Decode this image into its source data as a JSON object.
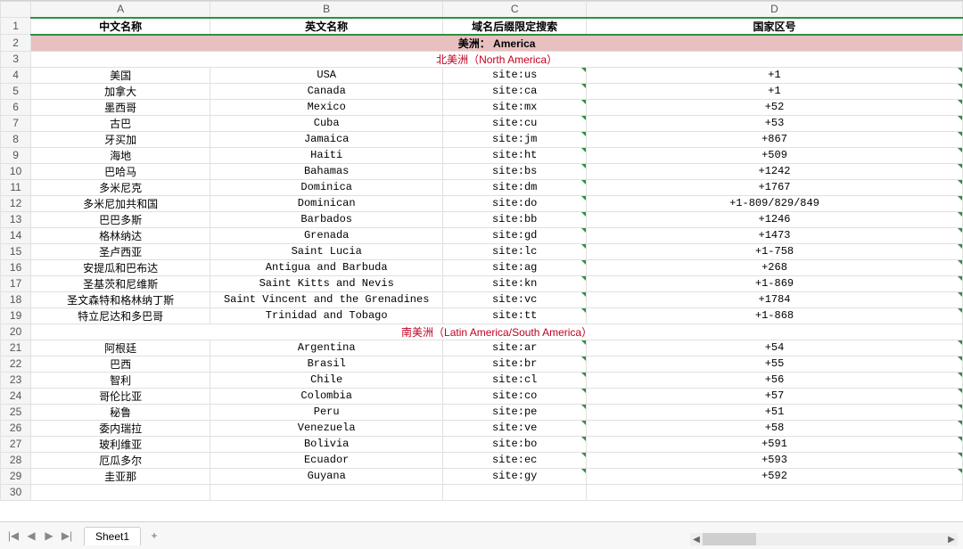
{
  "columns": [
    "A",
    "B",
    "C",
    "D"
  ],
  "headers": {
    "cn_name": "中文名称",
    "en_name": "英文名称",
    "site_search": "域名后缀限定搜索",
    "dial_code": "国家区号"
  },
  "band": {
    "label": "美洲： America"
  },
  "region_na": "北美洲（North America）",
  "region_sa": "南美洲（Latin America/South America）",
  "rows_na": [
    {
      "cn": "美国",
      "en": "USA",
      "site": "site:us",
      "code": "+1"
    },
    {
      "cn": "加拿大",
      "en": "Canada",
      "site": "site:ca",
      "code": "+1"
    },
    {
      "cn": "墨西哥",
      "en": "Mexico",
      "site": "site:mx",
      "code": "+52"
    },
    {
      "cn": "古巴",
      "en": "Cuba",
      "site": "site:cu",
      "code": "+53"
    },
    {
      "cn": "牙买加",
      "en": "Jamaica",
      "site": "site:jm",
      "code": "+867"
    },
    {
      "cn": "海地",
      "en": "Haiti",
      "site": "site:ht",
      "code": "+509"
    },
    {
      "cn": "巴哈马",
      "en": "Bahamas",
      "site": "site:bs",
      "code": "+1242"
    },
    {
      "cn": "多米尼克",
      "en": "Dominica",
      "site": "site:dm",
      "code": "+1767"
    },
    {
      "cn": "多米尼加共和国",
      "en": "Dominican",
      "site": "site:do",
      "code": "+1-809/829/849"
    },
    {
      "cn": "巴巴多斯",
      "en": "Barbados",
      "site": "site:bb",
      "code": "+1246"
    },
    {
      "cn": "格林纳达",
      "en": "Grenada",
      "site": "site:gd",
      "code": "+1473"
    },
    {
      "cn": "圣卢西亚",
      "en": "Saint Lucia",
      "site": "site:lc",
      "code": "+1-758"
    },
    {
      "cn": "安提瓜和巴布达",
      "en": "Antigua and Barbuda",
      "site": "site:ag",
      "code": "+268"
    },
    {
      "cn": "圣基茨和尼维斯",
      "en": "Saint Kitts and Nevis",
      "site": "site:kn",
      "code": "+1-869"
    },
    {
      "cn": "圣文森特和格林纳丁斯",
      "en": "Saint Vincent and the Grenadines",
      "site": "site:vc",
      "code": "+1784"
    },
    {
      "cn": "特立尼达和多巴哥",
      "en": "Trinidad and Tobago",
      "site": "site:tt",
      "code": "+1-868"
    }
  ],
  "rows_sa": [
    {
      "cn": "阿根廷",
      "en": "Argentina",
      "site": "site:ar",
      "code": "+54"
    },
    {
      "cn": "巴西",
      "en": "Brasil",
      "site": "site:br",
      "code": "+55"
    },
    {
      "cn": "智利",
      "en": "Chile",
      "site": "site:cl",
      "code": "+56"
    },
    {
      "cn": "哥伦比亚",
      "en": "Colombia",
      "site": "site:co",
      "code": "+57"
    },
    {
      "cn": "秘鲁",
      "en": "Peru",
      "site": "site:pe",
      "code": "+51"
    },
    {
      "cn": "委内瑞拉",
      "en": "Venezuela",
      "site": "site:ve",
      "code": "+58"
    },
    {
      "cn": "玻利维亚",
      "en": "Bolivia",
      "site": "site:bo",
      "code": "+591"
    },
    {
      "cn": "厄瓜多尔",
      "en": "Ecuador",
      "site": "site:ec",
      "code": "+593"
    },
    {
      "cn": "圭亚那",
      "en": "Guyana",
      "site": "site:gy",
      "code": "+592"
    }
  ],
  "tabs": {
    "first": "|◀",
    "prev": "◀",
    "next": "▶",
    "last": "▶|"
  },
  "sheet_name": "Sheet1",
  "add_sheet": "+",
  "hscroll": {
    "left": "◀",
    "right": "▶"
  }
}
